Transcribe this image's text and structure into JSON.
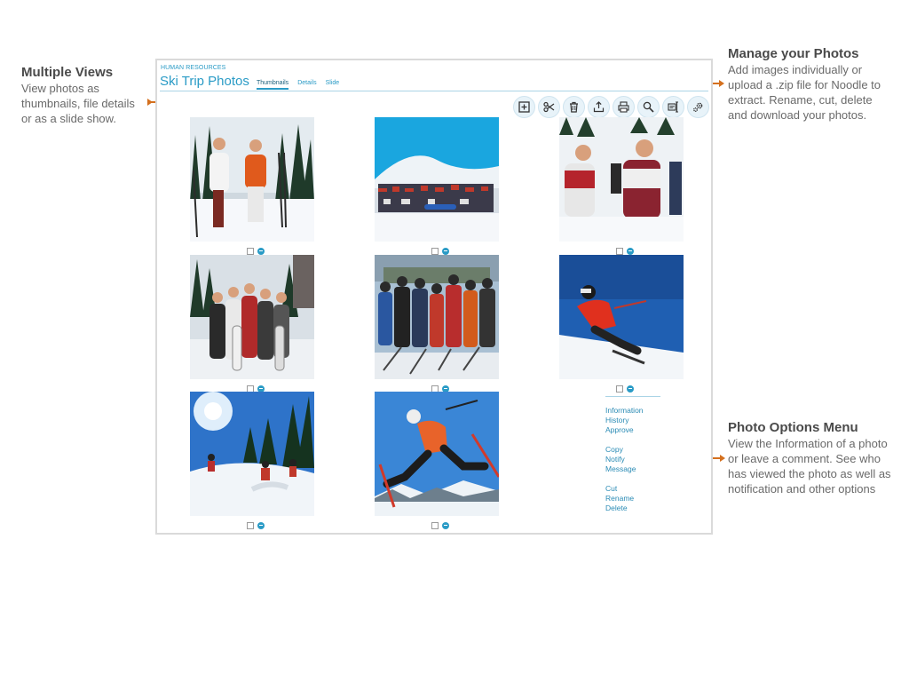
{
  "callouts": {
    "views": {
      "title": "Multiple Views",
      "lines": [
        "View photos as",
        "thumbnails, file details",
        "or as a slide show."
      ]
    },
    "manage": {
      "title": "Manage your Photos",
      "lines": [
        "Add images individually or",
        "upload a .zip file for Noodle to",
        "extract. Rename, cut, delete",
        "and download your photos."
      ]
    },
    "options": {
      "title": "Photo Options Menu",
      "lines": [
        "View the Information of a photo",
        "or leave a comment. See who",
        "has viewed the photo as well as",
        "notification and other options"
      ]
    }
  },
  "app": {
    "section": "HUMAN RESOURCES",
    "title": "Ski Trip Photos",
    "tabs": [
      {
        "label": "Thumbnails",
        "active": true
      },
      {
        "label": "Details",
        "active": false
      },
      {
        "label": "Slide",
        "active": false
      }
    ],
    "toolbar": [
      "add-icon",
      "scissors-icon",
      "trash-icon",
      "upload-icon",
      "print-icon",
      "search-icon",
      "rename-icon",
      "settings-icon"
    ]
  },
  "photos": [
    {
      "subject": "two skiers posing in forest"
    },
    {
      "subject": "large ski group photo"
    },
    {
      "subject": "ski couple close-up"
    },
    {
      "subject": "group with snowboards"
    },
    {
      "subject": "group of skiers at resort"
    },
    {
      "subject": "skier carving turn"
    },
    {
      "subject": "skiers descending in sun"
    },
    {
      "subject": "skier jumping"
    }
  ],
  "options_menu": {
    "groups": [
      [
        "Information",
        "History",
        "Approve"
      ],
      [
        "Copy",
        "Notify",
        "Message"
      ],
      [
        "Cut",
        "Rename",
        "Delete"
      ]
    ]
  },
  "colors": {
    "accent": "#2a9bc6",
    "leader": "#d4701e"
  }
}
